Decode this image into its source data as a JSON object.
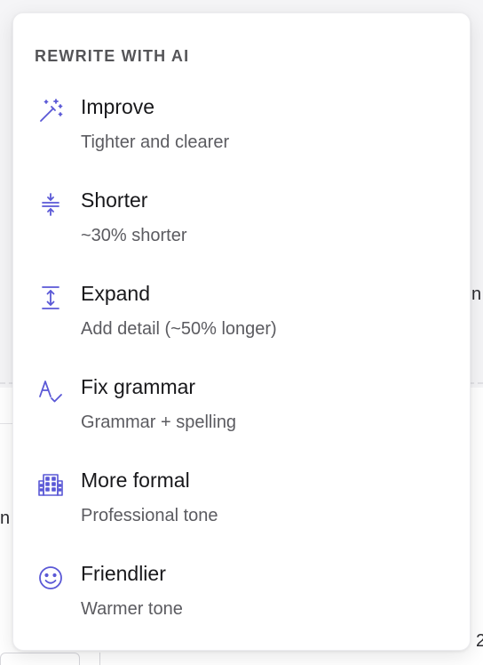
{
  "popover": {
    "title": "REWRITE WITH AI",
    "accent_color": "#5a58d6",
    "items": [
      {
        "label": "Improve",
        "description": "Tighter and clearer",
        "icon": "magic-wand-icon"
      },
      {
        "label": "Shorter",
        "description": "~30% shorter",
        "icon": "compress-vertical-icon"
      },
      {
        "label": "Expand",
        "description": "Add detail (~50% longer)",
        "icon": "expand-vertical-icon"
      },
      {
        "label": "Fix grammar",
        "description": "Grammar + spelling",
        "icon": "spell-check-icon"
      },
      {
        "label": "More formal",
        "description": "Professional tone",
        "icon": "building-icon"
      },
      {
        "label": "Friendlier",
        "description": "Warmer tone",
        "icon": "smile-icon"
      }
    ]
  },
  "background": {
    "frag_right": "n",
    "frag_left": "n",
    "frag_bottom": "2"
  }
}
